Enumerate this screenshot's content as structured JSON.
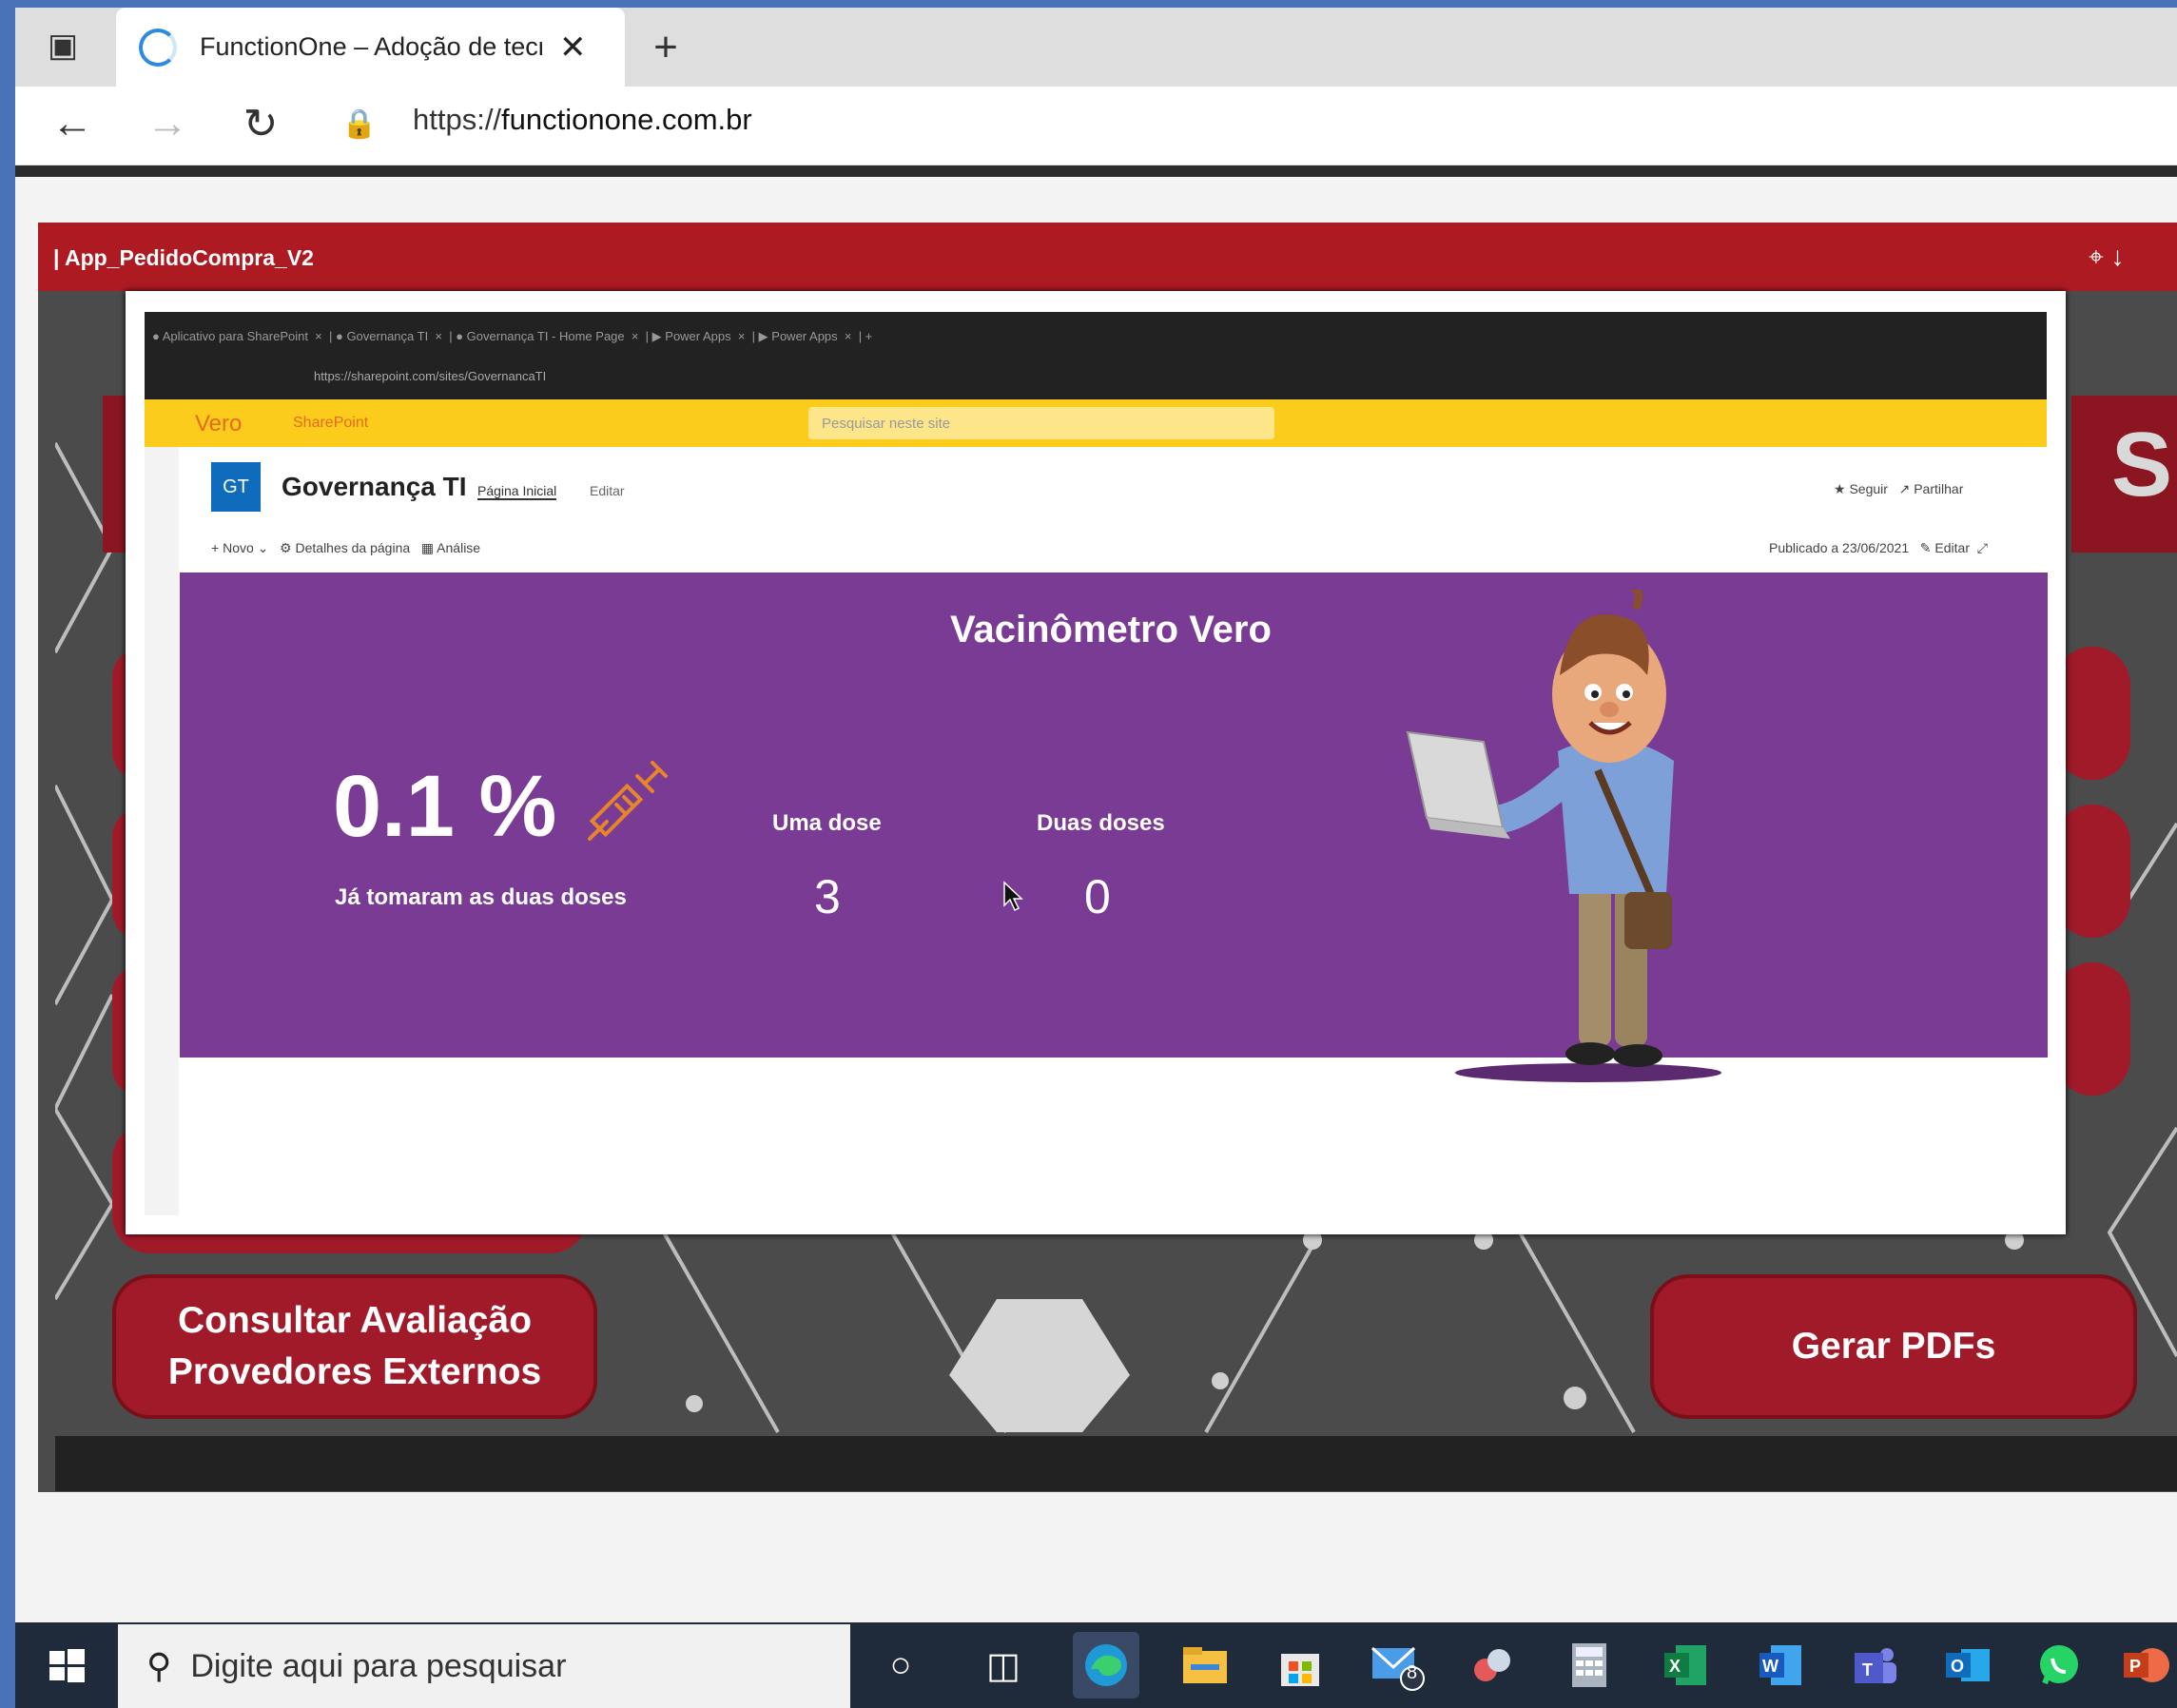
{
  "browser": {
    "tab_title": "FunctionOne – Adoção de tecno",
    "url_scheme": "https://",
    "url_host": "functionone.com.br"
  },
  "app": {
    "title": "| App_PedidoCompra_V2",
    "buttons": {
      "consultar_line1": "Consultar Avaliação",
      "consultar_line2": "Provedores Externos",
      "gerar": "Gerar PDFs"
    }
  },
  "shared_screen": {
    "brand": "Vero",
    "brand_app": "SharePoint",
    "search_placeholder": "Pesquisar neste site",
    "site_logo": "GT",
    "site_title": "Governança TI",
    "nav_home": "Página Inicial",
    "nav_edit": "Editar",
    "cmd_new": "Novo",
    "cmd_details": "Detalhes da página",
    "cmd_analytics": "Análise",
    "right_follow": "Seguir",
    "right_share": "Partilhar",
    "published": "Publicado a 23/06/2021",
    "edit": "Editar",
    "banner": {
      "title": "Vacinômetro Vero",
      "percent": "0.1 %",
      "percent_label": "Já tomaram as duas doses",
      "one_dose_label": "Uma dose",
      "one_dose_value": "3",
      "two_doses_label": "Duas doses",
      "two_doses_value": "0"
    }
  },
  "taskbar": {
    "search_placeholder": "Digite aqui para pesquisar",
    "mail_badge": "8"
  },
  "colors": {
    "app_red": "#ad1a22",
    "banner_purple": "#793b93",
    "sharepoint_yellow": "#fccc1c"
  }
}
